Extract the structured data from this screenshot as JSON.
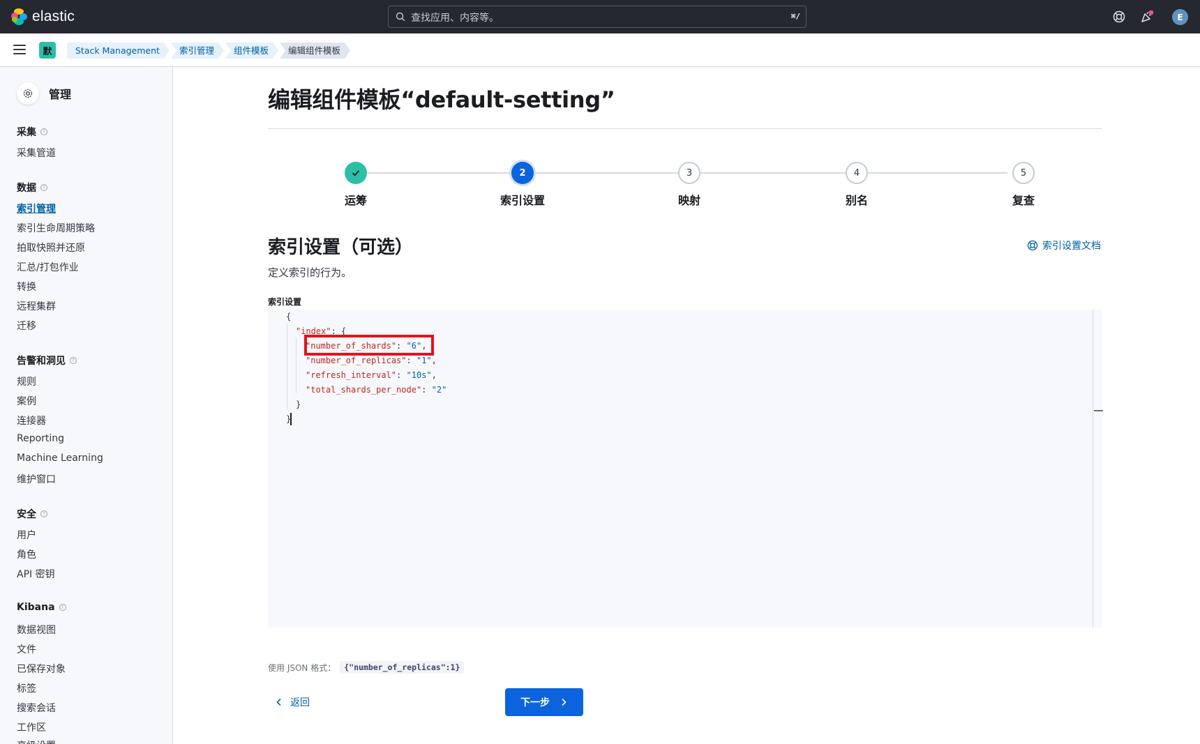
{
  "header": {
    "logo_text": "elastic",
    "search_placeholder": "查找应用、内容等。",
    "search_shortcut": "⌘/",
    "avatar_initial": "E"
  },
  "breadcrumbs": {
    "space_initial": "默",
    "items": [
      "Stack Management",
      "索引管理",
      "组件模板",
      "编辑组件模板"
    ]
  },
  "sidebar": {
    "title": "管理",
    "groups": [
      {
        "label": "采集",
        "items": [
          "采集管道"
        ]
      },
      {
        "label": "数据",
        "items": [
          "索引管理",
          "索引生命周期策略",
          "拍取快照并还原",
          "汇总/打包作业",
          "转换",
          "远程集群",
          "迁移"
        ]
      },
      {
        "label": "告警和洞见",
        "items": [
          "规则",
          "案例",
          "连接器",
          "Reporting",
          "Machine Learning",
          "维护窗口"
        ]
      },
      {
        "label": "安全",
        "items": [
          "用户",
          "角色",
          "API 密钥"
        ]
      },
      {
        "label": "Kibana",
        "items": [
          "数据视图",
          "文件",
          "已保存对象",
          "标签",
          "搜索会话",
          "工作区",
          "高级设置"
        ]
      }
    ],
    "active_item": "索引管理"
  },
  "main": {
    "page_title": "编辑组件模板“default-setting”",
    "steps": [
      {
        "number": "",
        "label": "运筹",
        "state": "done"
      },
      {
        "number": "2",
        "label": "索引设置",
        "state": "current"
      },
      {
        "number": "3",
        "label": "映射",
        "state": "todo"
      },
      {
        "number": "4",
        "label": "别名",
        "state": "todo"
      },
      {
        "number": "5",
        "label": "复查",
        "state": "todo"
      }
    ],
    "section_title": "索引设置（可选）",
    "section_desc": "定义索引的行为。",
    "doc_link": "索引设置文档",
    "field_label": "索引设置",
    "code": {
      "open_brace": "{",
      "index_key": "\"index\"",
      "shards_key": "\"number_of_shards\"",
      "shards_val": "\"6\"",
      "replicas_key": "\"number_of_replicas\"",
      "replicas_val": "\"1\"",
      "refresh_key": "\"refresh_interval\"",
      "refresh_val": "\"10s\"",
      "total_key": "\"total_shards_per_node\"",
      "total_val": "\"2\"",
      "close_inner": "}",
      "close_brace": "}"
    },
    "help_prefix": "使用 JSON 格式：",
    "help_example": "{\"number_of_replicas\":1}",
    "back_label": "返回",
    "next_label": "下一步"
  },
  "colors": {
    "topbar": "#25282f",
    "accent": "#0b64dd",
    "success": "#2bbfa6",
    "highlight": "#e0141e"
  }
}
